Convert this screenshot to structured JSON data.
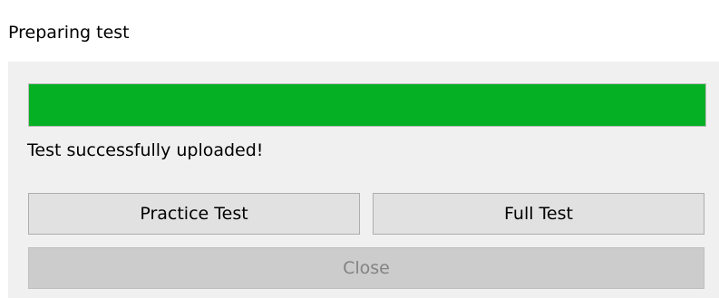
{
  "dialog": {
    "title": "Preparing test"
  },
  "progress": {
    "fraction": 1.0,
    "fill_color": "#06b025"
  },
  "status": {
    "message": "Test successfully uploaded!"
  },
  "buttons": {
    "practice_label": "Practice Test",
    "full_label": "Full Test",
    "close_label": "Close",
    "close_enabled": false
  }
}
